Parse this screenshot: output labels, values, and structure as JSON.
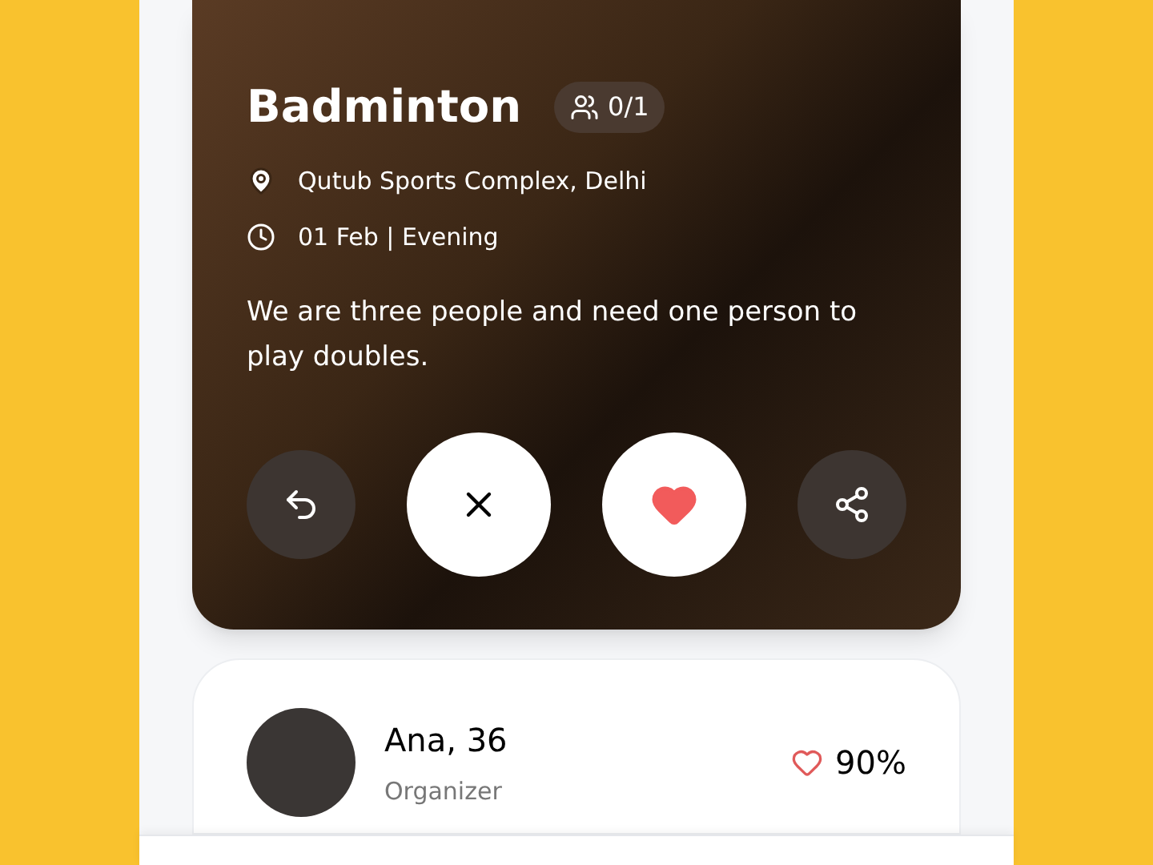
{
  "event": {
    "title": "Badminton",
    "spots": "0/1",
    "location": "Qutub Sports Complex, Delhi",
    "time": "01 Feb | Evening",
    "description": "We are three people and need one person to play doubles."
  },
  "actions": [
    {
      "kind": "undo"
    },
    {
      "kind": "dismiss"
    },
    {
      "kind": "like"
    },
    {
      "kind": "share"
    }
  ],
  "organizer": {
    "name": "Ana, 36",
    "role": "Organizer",
    "match": "90%"
  }
}
